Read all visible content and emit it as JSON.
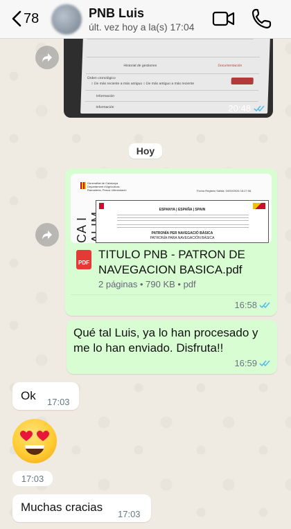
{
  "header": {
    "back_count": "78",
    "contact_name": "PNB Luis",
    "last_seen": "últ. vez hoy a la(s) 17:04"
  },
  "messages": {
    "image": {
      "time": "20:48"
    },
    "date_chip": "Hoy",
    "pdf": {
      "icon_label": "PDF",
      "title": "TITULO PNB - PATRON DE NAVEGACION BASICA.pdf",
      "meta": "2 páginas • 790 KB • pdf",
      "time": "16:58"
    },
    "out_text": {
      "text": "Qué tal Luis, ya lo han procesado y me lo han enviado. Disfruta!!",
      "time": "16:59"
    },
    "ok": {
      "text": "Ok",
      "time": "17:03"
    },
    "emoji": {
      "symbol": "heart-eyes-emoji",
      "time": "17:03"
    },
    "thanks": {
      "text": "Muchas cracias",
      "time": "17:03"
    }
  },
  "colors": {
    "outgoing_bubble": "#d9fdd3",
    "incoming_bubble": "#ffffff",
    "read_ticks": "#53bdeb",
    "chat_background": "#efeae2"
  }
}
